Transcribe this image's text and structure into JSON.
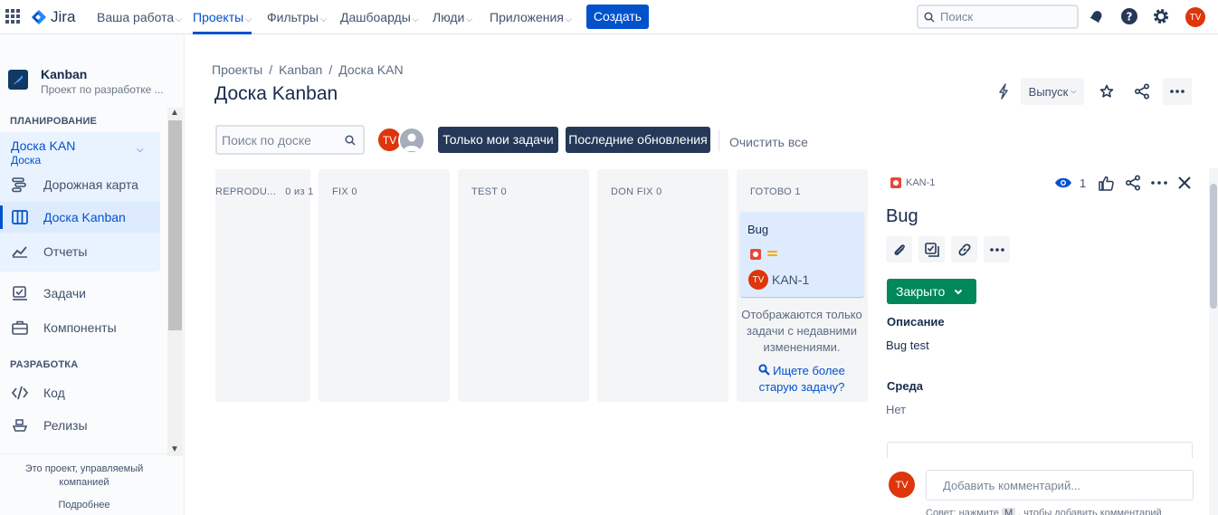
{
  "topnav": {
    "logo_text": "Jira",
    "items": [
      {
        "label": "Ваша работа"
      },
      {
        "label": "Проекты"
      },
      {
        "label": "Фильтры"
      },
      {
        "label": "Дашбоарды"
      },
      {
        "label": "Люди"
      },
      {
        "label": "Приложения"
      }
    ],
    "create_label": "Создать",
    "search_placeholder": "Поиск",
    "avatar_initials": "TV",
    "accent_color": "#0052cc"
  },
  "sidebar": {
    "project_name": "Kanban",
    "project_sub": "Проект по разработке ...",
    "planning_title": "ПЛАНИРОВАНИЕ",
    "board_group_title": "Доска KAN",
    "board_group_sub": "Доска",
    "planning_items": [
      {
        "label": "Дорожная карта",
        "icon": "roadmap-icon"
      },
      {
        "label": "Доска Kanban",
        "icon": "board-icon"
      },
      {
        "label": "Отчеты",
        "icon": "reports-icon"
      }
    ],
    "items": [
      {
        "label": "Задачи",
        "icon": "issues-icon"
      },
      {
        "label": "Компоненты",
        "icon": "components-icon"
      }
    ],
    "dev_title": "РАЗРАБОТКА",
    "dev_items": [
      {
        "label": "Код",
        "icon": "code-icon"
      },
      {
        "label": "Релизы",
        "icon": "releases-icon"
      }
    ],
    "footer_text": "Это проект, управляемый компанией",
    "footer_link": "Подробнее"
  },
  "breadcrumb": {
    "items": [
      "Проекты",
      "Kanban",
      "Доска KAN"
    ]
  },
  "page_title": "Доска Kanban",
  "header_actions": {
    "release_label": "Выпуск"
  },
  "filters": {
    "search_placeholder": "Поиск по доске",
    "avatar_initials": "TV",
    "only_my_issues": "Только мои задачи",
    "recently_updated": "Последние обновления",
    "clear_all": "Очистить все"
  },
  "columns": [
    {
      "name": "REPRODU...",
      "count": "0 из 1"
    },
    {
      "name": "FIX",
      "count": "0"
    },
    {
      "name": "TEST",
      "count": "0"
    },
    {
      "name": "DON FIX",
      "count": "0"
    },
    {
      "name": "ГОТОВО",
      "count": "1"
    }
  ],
  "card": {
    "title": "Bug",
    "key": "KAN-1",
    "assignee": "TV"
  },
  "done_note": "Отображаются только задачи с недавними изменениями.",
  "older_link": "Ищете более старую задачу?",
  "detail": {
    "key": "KAN-1",
    "watchers": "1",
    "title": "Bug",
    "status": "Закрыто",
    "status_color": "#00875a",
    "description_label": "Описание",
    "description": "Bug test",
    "environment_label": "Среда",
    "environment": "Нет",
    "comment_avatar": "TV",
    "comment_placeholder": "Добавить комментарий...",
    "tip_prefix": "Совет: нажмите",
    "tip_key": "M",
    "tip_suffix": ", чтобы добавить комментарий"
  }
}
